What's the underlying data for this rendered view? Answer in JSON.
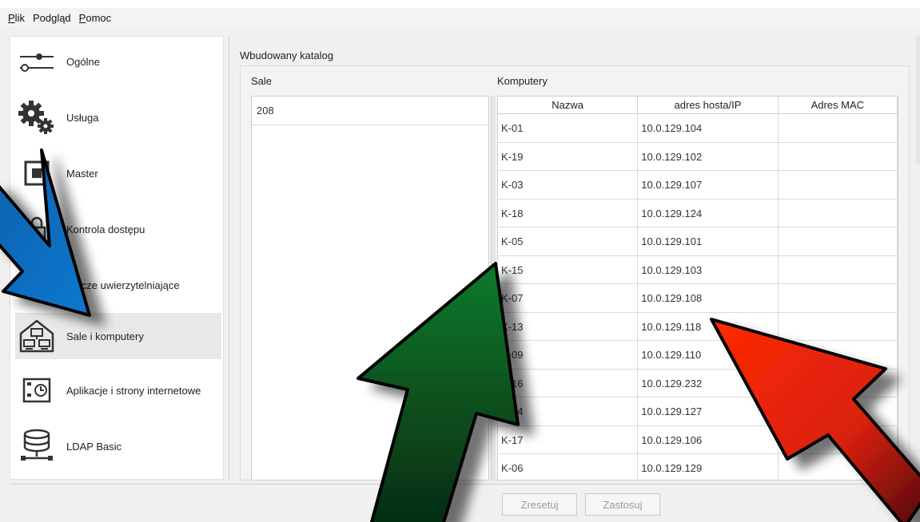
{
  "menubar": {
    "items": [
      {
        "label": "Plik",
        "name": "menu-plik"
      },
      {
        "label": "Podgląd",
        "name": "menu-podglad"
      },
      {
        "label": "Pomoc",
        "name": "menu-pomoc"
      }
    ]
  },
  "sidebar": {
    "items": [
      {
        "label": "Ogólne",
        "icon": "sliders-icon"
      },
      {
        "label": "Usługa",
        "icon": "gears-icon"
      },
      {
        "label": "Master",
        "icon": "master-icon"
      },
      {
        "label": "Kontrola dostępu",
        "icon": "access-control-icon"
      },
      {
        "label": "Klucze uwierzytelniające",
        "icon": "key-icon"
      },
      {
        "label": "Sale i komputery",
        "icon": "rooms-computers-icon",
        "active": true
      },
      {
        "label": "Aplikacje i strony internetowe",
        "icon": "apps-websites-icon"
      },
      {
        "label": "LDAP Basic",
        "icon": "ldap-database-icon"
      }
    ]
  },
  "main": {
    "title": "Wbudowany katalog",
    "sale_label": "Sale",
    "komputery_label": "Komputery",
    "sale": [
      "208"
    ],
    "columns": [
      "Nazwa",
      "adres hosta/IP",
      "Adres MAC"
    ],
    "computers": [
      {
        "name": "K-01",
        "host": "10.0.129.104",
        "mac": ""
      },
      {
        "name": "K-19",
        "host": "10.0.129.102",
        "mac": ""
      },
      {
        "name": "K-03",
        "host": "10.0.129.107",
        "mac": ""
      },
      {
        "name": "K-18",
        "host": "10.0.129.124",
        "mac": ""
      },
      {
        "name": "K-05",
        "host": "10.0.129.101",
        "mac": ""
      },
      {
        "name": "K-15",
        "host": "10.0.129.103",
        "mac": ""
      },
      {
        "name": "K-07",
        "host": "10.0.129.108",
        "mac": ""
      },
      {
        "name": "K-13",
        "host": "10.0.129.118",
        "mac": ""
      },
      {
        "name": "K-09",
        "host": "10.0.129.110",
        "mac": ""
      },
      {
        "name": "K-16",
        "host": "10.0.129.232",
        "mac": ""
      },
      {
        "name": "K-14",
        "host": "10.0.129.127",
        "mac": ""
      },
      {
        "name": "K-17",
        "host": "10.0.129.106",
        "mac": ""
      },
      {
        "name": "K-06",
        "host": "10.0.129.129",
        "mac": ""
      }
    ]
  },
  "buttons": {
    "reset": "Zresetuj",
    "apply": "Zastosuj"
  },
  "colors": {
    "arrow_blue": "#0a6fc2",
    "arrow_green": "#0f6b2a",
    "arrow_red": "#e82a0c"
  }
}
